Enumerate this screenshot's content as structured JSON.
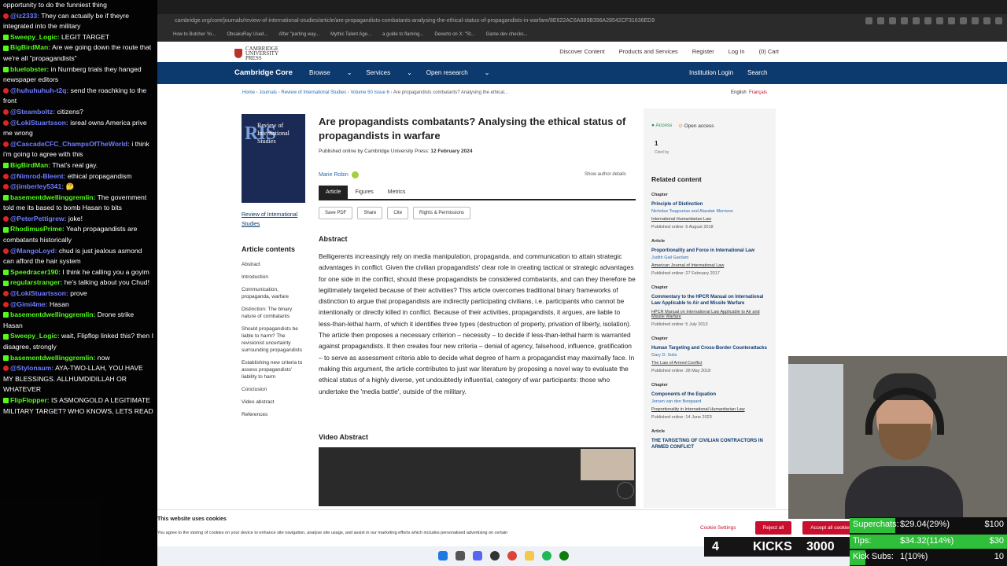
{
  "browser": {
    "url": "cambridge.org/core/journals/review-of-international-studies/article/are-propagandists-combatants-analysing-the-ethical-status-of-propagandists-in-warfare/8E622AC6A889B396A28542CF31636ED9",
    "bookmarks": [
      "How to Butcher Yo...",
      "ObsakuRay Used...",
      "After \"parting way...",
      "Mythic Talent Age...",
      "a guide to flaming...",
      "Dexerto on X: \"St...",
      "Game dev checks..."
    ]
  },
  "site": {
    "publisher": "CAMBRIDGE UNIVERSITY PRESS",
    "top_links": [
      "Discover Content",
      "Products and Services",
      "Register",
      "Log In",
      "(0) Cart"
    ],
    "logo": "Cambridge Core",
    "nav": [
      "Browse",
      "Services",
      "Open research"
    ],
    "nav_right": [
      "Institution Login",
      "Search"
    ],
    "breadcrumbs": [
      "Home",
      "Journals",
      "Review of International Studies",
      "Volume 50 Issue 6"
    ],
    "breadcrumb_current": "Are propagandists combatants? Analysing the ethical...",
    "lang_en": "English",
    "lang_fr": "Français"
  },
  "article": {
    "cover_title": "Review of International Studies",
    "cover_abbr": "RIS",
    "journal_link": "Review of International Studies",
    "contents_heading": "Article contents",
    "contents": [
      "Abstract",
      "Introduction",
      "Communication, propaganda, warfare",
      "Distinction: The binary nature of combatants",
      "Should propagandists be liable to harm? The revisionist uncertainty surrounding propagandists",
      "Establishing new criteria to assess propagandists' liability to harm",
      "Conclusion",
      "Video abstract",
      "References"
    ],
    "title": "Are propagandists combatants? Analysing the ethical status of propagandists in warfare",
    "published_prefix": "Published online by Cambridge University Press: ",
    "published_date": "12 February 2024",
    "author": "Marie Robin",
    "show_author": "Show author details",
    "tabs": [
      "Article",
      "Figures",
      "Metrics"
    ],
    "actions": [
      "Save PDF",
      "Share",
      "Cite",
      "Rights & Permissions"
    ],
    "abstract_heading": "Abstract",
    "abstract": "Belligerents increasingly rely on media manipulation, propaganda, and communication to attain strategic advantages in conflict. Given the civilian propagandists' clear role in creating tactical or strategic advantages for one side in the conflict, should these propagandists be considered combatants, and can they therefore be legitimately targeted because of their activities? This article overcomes traditional binary frameworks of distinction to argue that propagandists are indirectly participating civilians, i.e. participants who cannot be intentionally or directly killed in conflict. Because of their activities, propagandists, it argues, are liable to less-than-lethal harm, of which it identifies three types (destruction of property, privation of liberty, isolation). The article then proposes a necessary criterion – necessity – to decide if less-than-lethal harm is warranted against propagandists. It then creates four new criteria – denial of agency, falsehood, influence, gratification – to serve as assessment criteria able to decide what degree of harm a propagandist may maximally face. In making this argument, the article contributes to just war literature by proposing a novel way to evaluate the ethical status of a highly diverse, yet undoubtedly influential, category of war participants: those who undertake the 'media battle', outside of the military.",
    "video_heading": "Video Abstract"
  },
  "sidebar": {
    "access": "Access",
    "open_access": "Open access",
    "cited_count": "1",
    "cited_label": "Cited by",
    "related_heading": "Related content",
    "related": [
      {
        "type": "Chapter",
        "title": "Principle of Distinction",
        "authors": "Nicholas Tsagourias and Alasdair Morrison",
        "journal": "International Humanitarian Law",
        "date": "Published online: 6 August 2018"
      },
      {
        "type": "Article",
        "title": "Proportionality and Force in International Law",
        "authors": "Judith Gail Gardam",
        "journal": "American Journal of International Law",
        "date": "Published online: 27 February 2017"
      },
      {
        "type": "Chapter",
        "title": "Commentary to the HPCR Manual on International Law Applicable to Air and Missile Warfare",
        "authors": "",
        "journal": "HPCR Manual on International Law Applicable to Air and Missile Warfare",
        "date": "Published online: 5 July 2013"
      },
      {
        "type": "Chapter",
        "title": "Human Targeting and Cross-Border Counterattacks",
        "authors": "Gary D. Solis",
        "journal": "The Law of Armed Conflict",
        "date": "Published online: 28 May 2018"
      },
      {
        "type": "Chapter",
        "title": "Components of the Equation",
        "authors": "Jeroen van den Boogaard",
        "journal": "Proportionality in International Humanitarian Law",
        "date": "Published online: 14 June 2023"
      },
      {
        "type": "Article",
        "title": "THE TARGETING OF CIVILIAN CONTRACTORS IN ARMED CONFLICT",
        "authors": "",
        "journal": "",
        "date": ""
      }
    ]
  },
  "cookie": {
    "heading": "This website uses cookies",
    "text": "You agree to the storing of cookies on your device to enhance site navigation, analyse site usage, and assist in our marketing efforts which includes personalised advertising on certain",
    "settings": "Cookie Settings",
    "reject": "Reject all",
    "accept": "Accept all cookies"
  },
  "chat": [
    {
      "p": "yt",
      "u": "",
      "t": "opportunity to do the funniest thing"
    },
    {
      "p": "yt",
      "u": "@iz2333:",
      "t": "They can actually be if theyre integrated into the military"
    },
    {
      "p": "kick",
      "u": "Sweepy_Logic:",
      "t": "LEGIT TARGET"
    },
    {
      "p": "kick",
      "u": "BigBirdMan:",
      "t": "Are we going down the route that we're all \"propagandists\""
    },
    {
      "p": "kick",
      "u": "bluelobster:",
      "t": "in Nurnberg trials they hanged newspaper editors"
    },
    {
      "p": "yt",
      "u": "@huhuhuhuh-t2q:",
      "t": "send the roachking to the front"
    },
    {
      "p": "yt",
      "u": "@Steamboltz:",
      "t": "citizens?"
    },
    {
      "p": "yt",
      "u": "@LokiStuartsson:",
      "t": "isreal owns America prive me wrong"
    },
    {
      "p": "yt",
      "u": "@CascadeCFC_ChampsOfTheWorld:",
      "t": "i think i'm going to agree with this"
    },
    {
      "p": "kick",
      "u": "BigBirdMan:",
      "t": "That's real gay."
    },
    {
      "p": "yt",
      "u": "@Nimrod-Bleent:",
      "t": "ethical propagandism"
    },
    {
      "p": "yt",
      "u": "@jimberley5341:",
      "t": "🤔"
    },
    {
      "p": "kick",
      "u": "basementdwellinggremlin:",
      "t": "The government told me its based to bomb Hasan to bits"
    },
    {
      "p": "yt",
      "u": "@PeterPettigrew:",
      "t": "joke!"
    },
    {
      "p": "kick",
      "u": "RhodimusPrime:",
      "t": "Yeah propagandists are combatants historically"
    },
    {
      "p": "yt",
      "u": "@MangoLoyd:",
      "t": "chud is just jealous asmond can afford the hair system"
    },
    {
      "p": "kick",
      "u": "Speedracer190:",
      "t": "I think he calling you a goyim"
    },
    {
      "p": "kick",
      "u": "regularstranger:",
      "t": "he's talking about you Chud!"
    },
    {
      "p": "yt",
      "u": "@LokiStuartsson:",
      "t": "prove"
    },
    {
      "p": "yt",
      "u": "@Gimi4me:",
      "t": "Hasan"
    },
    {
      "p": "kick",
      "u": "basementdwellinggremlin:",
      "t": "Drone strike Hasan"
    },
    {
      "p": "kick",
      "u": "Sweepy_Logic:",
      "t": "wait, Flipflop linked this? then I disagree, strongly"
    },
    {
      "p": "kick",
      "u": "basementdwellinggremlin:",
      "t": "now"
    },
    {
      "p": "yt",
      "u": "@Stylonaum:",
      "t": "AYA-TWO-LLAH, YOU HAVE MY BLESSINGS. ALLHUMDIDILLAH OR WHATEVER"
    },
    {
      "p": "kick",
      "u": "FlipFlopper:",
      "t": "IS ASMONGOLD A LEGITIMATE MILITARY TARGET? WHO KNOWS, LETS READ"
    }
  ],
  "overlay": {
    "kicks_count": "4",
    "kicks_label": "KICKS",
    "kicks_goal": "3000",
    "stats": [
      {
        "label": "Superchats:",
        "value": "$29.04(29%)",
        "goal": "$100",
        "fill": 0.29
      },
      {
        "label": "Tips:",
        "value": "$34.32(114%)",
        "goal": "$30",
        "fill": 1.0
      },
      {
        "label": "Kick Subs:",
        "value": "1(10%)",
        "goal": "10",
        "fill": 0.1
      }
    ]
  },
  "colors": {
    "nav_blue": "#0d3a6e",
    "accent_red": "#c8102e",
    "kick_green": "#53fc18"
  }
}
